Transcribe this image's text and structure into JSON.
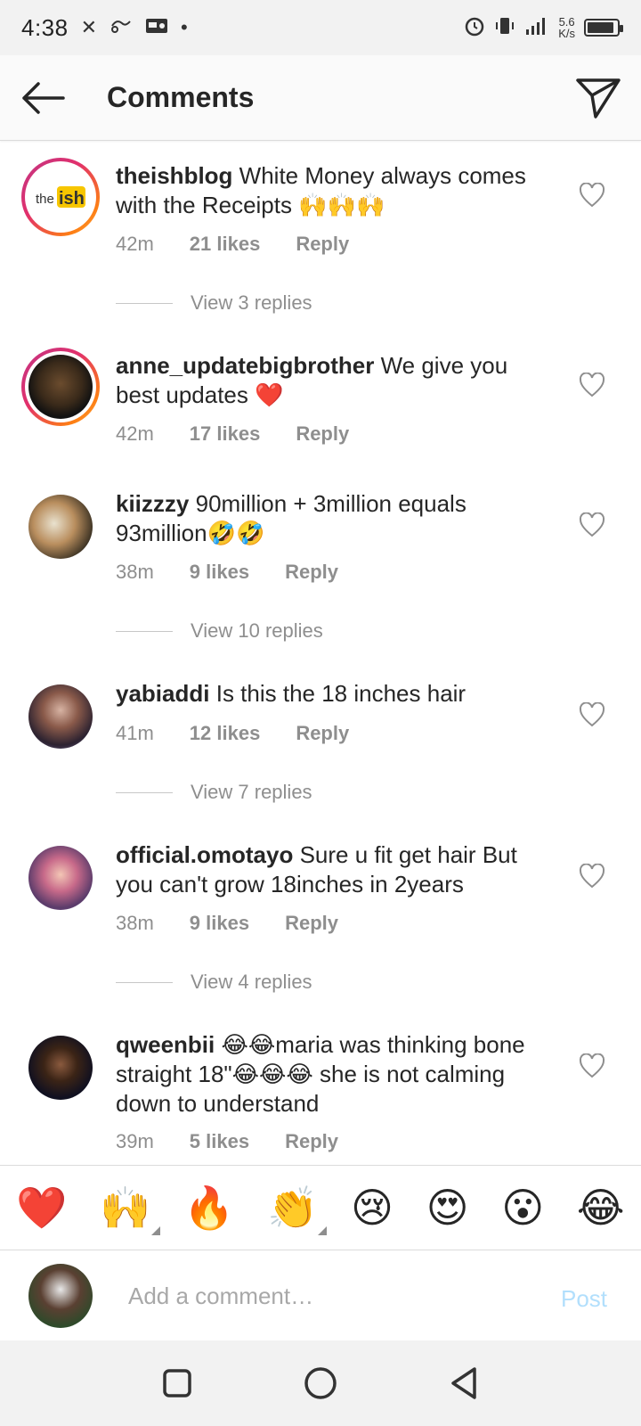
{
  "status_bar": {
    "time": "4:38",
    "net_speed_value": "5.6",
    "net_speed_unit": "K/s",
    "battery_level": 0.9
  },
  "header": {
    "title": "Comments"
  },
  "comments": [
    {
      "username": "theishblog",
      "text": "White Money always comes with the Receipts 🙌🙌🙌",
      "time": "42m",
      "likes": "21 likes",
      "reply": "Reply",
      "view_replies": "View 3 replies"
    },
    {
      "username": "anne_updatebigbrother",
      "text": "We give you best updates ❤️",
      "time": "42m",
      "likes": "17 likes",
      "reply": "Reply"
    },
    {
      "username": "kiizzzy",
      "text": "90million + 3million equals 93million🤣🤣",
      "time": "38m",
      "likes": "9 likes",
      "reply": "Reply",
      "view_replies": "View 10 replies"
    },
    {
      "username": "yabiaddi",
      "text": "Is this the 18 inches hair",
      "time": "41m",
      "likes": "12 likes",
      "reply": "Reply",
      "view_replies": "View 7 replies"
    },
    {
      "username": "official.omotayo",
      "text": "Sure u fit get hair But you can't grow 18inches in 2years",
      "time": "38m",
      "likes": "9 likes",
      "reply": "Reply",
      "view_replies": "View 4 replies"
    },
    {
      "username": "qweenbii",
      "text": "😂😂maria was thinking bone straight 18\"😂😂😂 she is not calming down to understand",
      "time": "39m",
      "likes": "5 likes",
      "reply": "Reply"
    }
  ],
  "emoji_bar": [
    "❤️",
    "🙌",
    "🔥",
    "👏",
    "😢",
    "😍",
    "😮",
    "😂"
  ],
  "composer": {
    "placeholder": "Add a comment…",
    "post_label": "Post"
  },
  "colors": {
    "link_disabled": "#b2dffc",
    "secondary_text": "#8e8e8e",
    "story_ring": "#e1306c"
  }
}
